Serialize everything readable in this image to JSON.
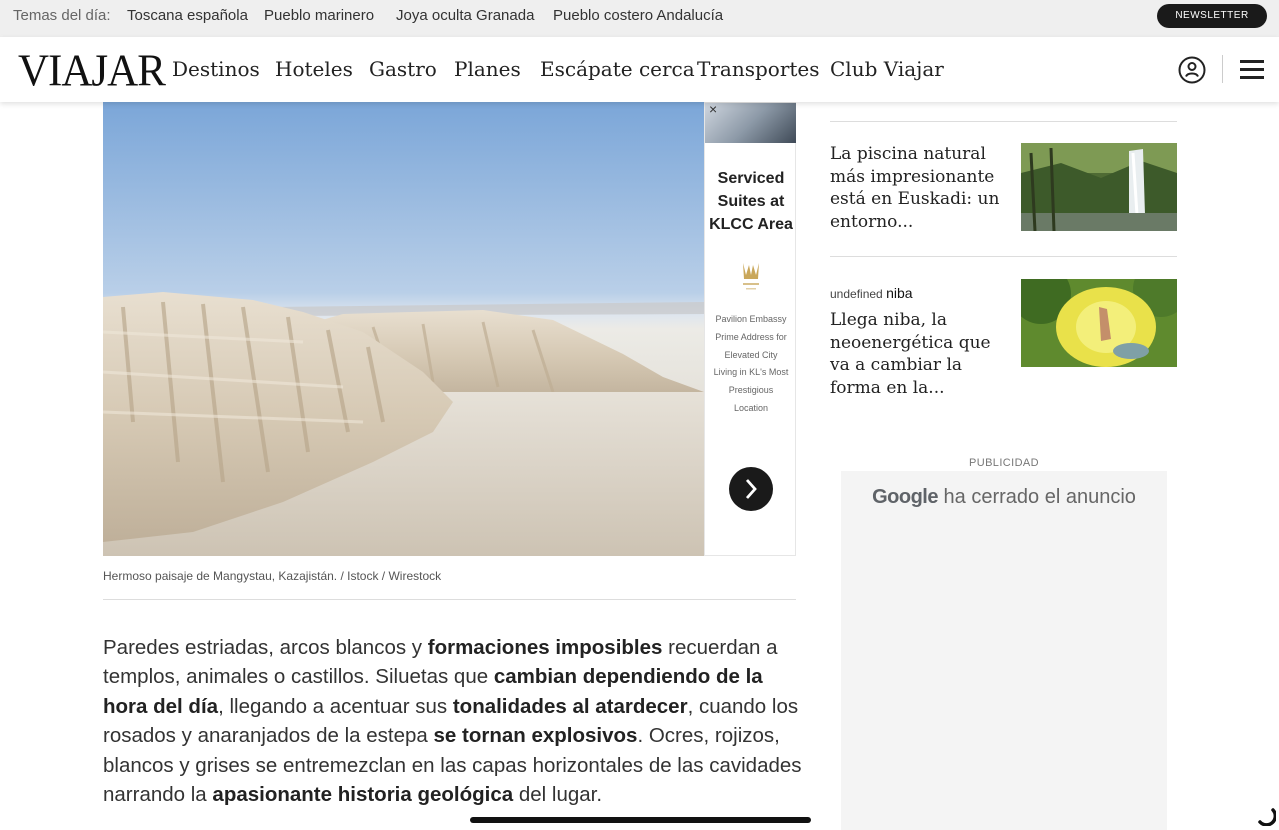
{
  "topics": {
    "label": "Temas del día:",
    "items": [
      "Toscana española",
      "Pueblo marinero",
      "Joya oculta Granada",
      "Pueblo costero Andalucía"
    ],
    "newsletter_label": "NEWSLETTER"
  },
  "nav": {
    "logo": "VIAJAR",
    "items": [
      "Destinos",
      "Hoteles",
      "Gastro",
      "Planes",
      "Escápate cerca",
      "Transportes",
      "Club Viajar"
    ]
  },
  "hero": {
    "caption": "Hermoso paisaje de Mangystau, Kazajistán. / Istock / Wirestock"
  },
  "hero_ad": {
    "close": "×",
    "title": "Serviced Suites at KLCC Area",
    "body": "Pavilion Embassy Prime Address for Elevated City Living in KL's Most Prestigious Location"
  },
  "sidebar": {
    "articles": [
      {
        "title": "La piscina natural más impresionante está en Euskadi: un entorno..."
      },
      {
        "sponsor_prefix": "undefined",
        "sponsor_brand": "niba",
        "title": "Llega niba, la neoenergética que va a cambiar la forma en la..."
      }
    ],
    "ad_label": "PUBLICIDAD",
    "ad_closed_brand": "Google",
    "ad_closed_text": "ha cerrado el anuncio"
  },
  "article": {
    "segments": [
      {
        "text": "Paredes estriadas, arcos blancos y ",
        "bold": false
      },
      {
        "text": "formaciones imposibles",
        "bold": true
      },
      {
        "text": " recuerdan a templos, animales o castillos. Siluetas que ",
        "bold": false
      },
      {
        "text": "cambian dependiendo de la hora del día",
        "bold": true
      },
      {
        "text": ", llegando a acentuar sus ",
        "bold": false
      },
      {
        "text": "tonalidades al atardecer",
        "bold": true
      },
      {
        "text": ", cuando los rosados y anaranjados de la estepa ",
        "bold": false
      },
      {
        "text": "se tornan explosivos",
        "bold": true
      },
      {
        "text": ". Ocres, rojizos, blancos y grises se entremezclan en las capas horizontales de las cavidades narrando la ",
        "bold": false
      },
      {
        "text": "apasionante historia geológica",
        "bold": true
      },
      {
        "text": " del lugar.",
        "bold": false
      }
    ]
  },
  "colors": {
    "topics_bg": "#efefef",
    "newsletter_bg": "#1a1a1a",
    "ad_bg": "#f4f4f4"
  }
}
